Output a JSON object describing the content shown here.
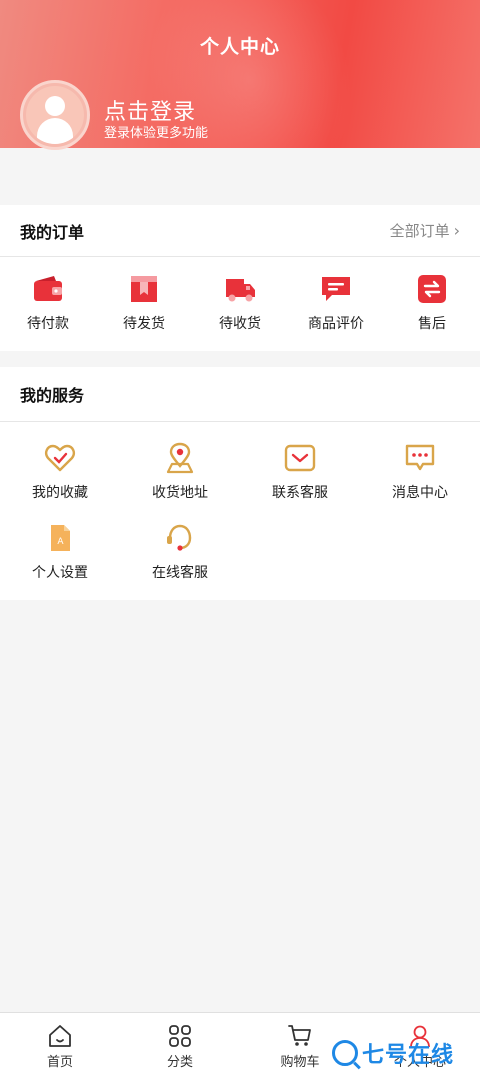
{
  "header": {
    "title": "个人中心",
    "login_title": "点击登录",
    "login_subtitle": "登录体验更多功能"
  },
  "orders": {
    "title": "我的订单",
    "all_link": "全部订单",
    "items": [
      {
        "label": "待付款",
        "icon": "wallet-icon"
      },
      {
        "label": "待发货",
        "icon": "box-icon"
      },
      {
        "label": "待收货",
        "icon": "truck-icon"
      },
      {
        "label": "商品评价",
        "icon": "comment-icon"
      },
      {
        "label": "售后",
        "icon": "exchange-icon"
      }
    ]
  },
  "services": {
    "title": "我的服务",
    "items": [
      {
        "label": "我的收藏",
        "icon": "heart-icon"
      },
      {
        "label": "收货地址",
        "icon": "location-pin-icon"
      },
      {
        "label": "联系客服",
        "icon": "mail-icon"
      },
      {
        "label": "消息中心",
        "icon": "message-icon"
      },
      {
        "label": "个人设置",
        "icon": "settings-file-icon"
      },
      {
        "label": "在线客服",
        "icon": "headset-icon"
      }
    ]
  },
  "tabbar": {
    "items": [
      {
        "label": "首页",
        "icon": "home-icon"
      },
      {
        "label": "分类",
        "icon": "grid-icon"
      },
      {
        "label": "购物车",
        "icon": "cart-icon"
      },
      {
        "label": "个人中心",
        "icon": "user-icon"
      }
    ]
  },
  "watermark": {
    "text": "七号在线"
  },
  "colors": {
    "accent": "#f04a44",
    "gold": "#d9a54a",
    "background": "#f5f5f5"
  }
}
